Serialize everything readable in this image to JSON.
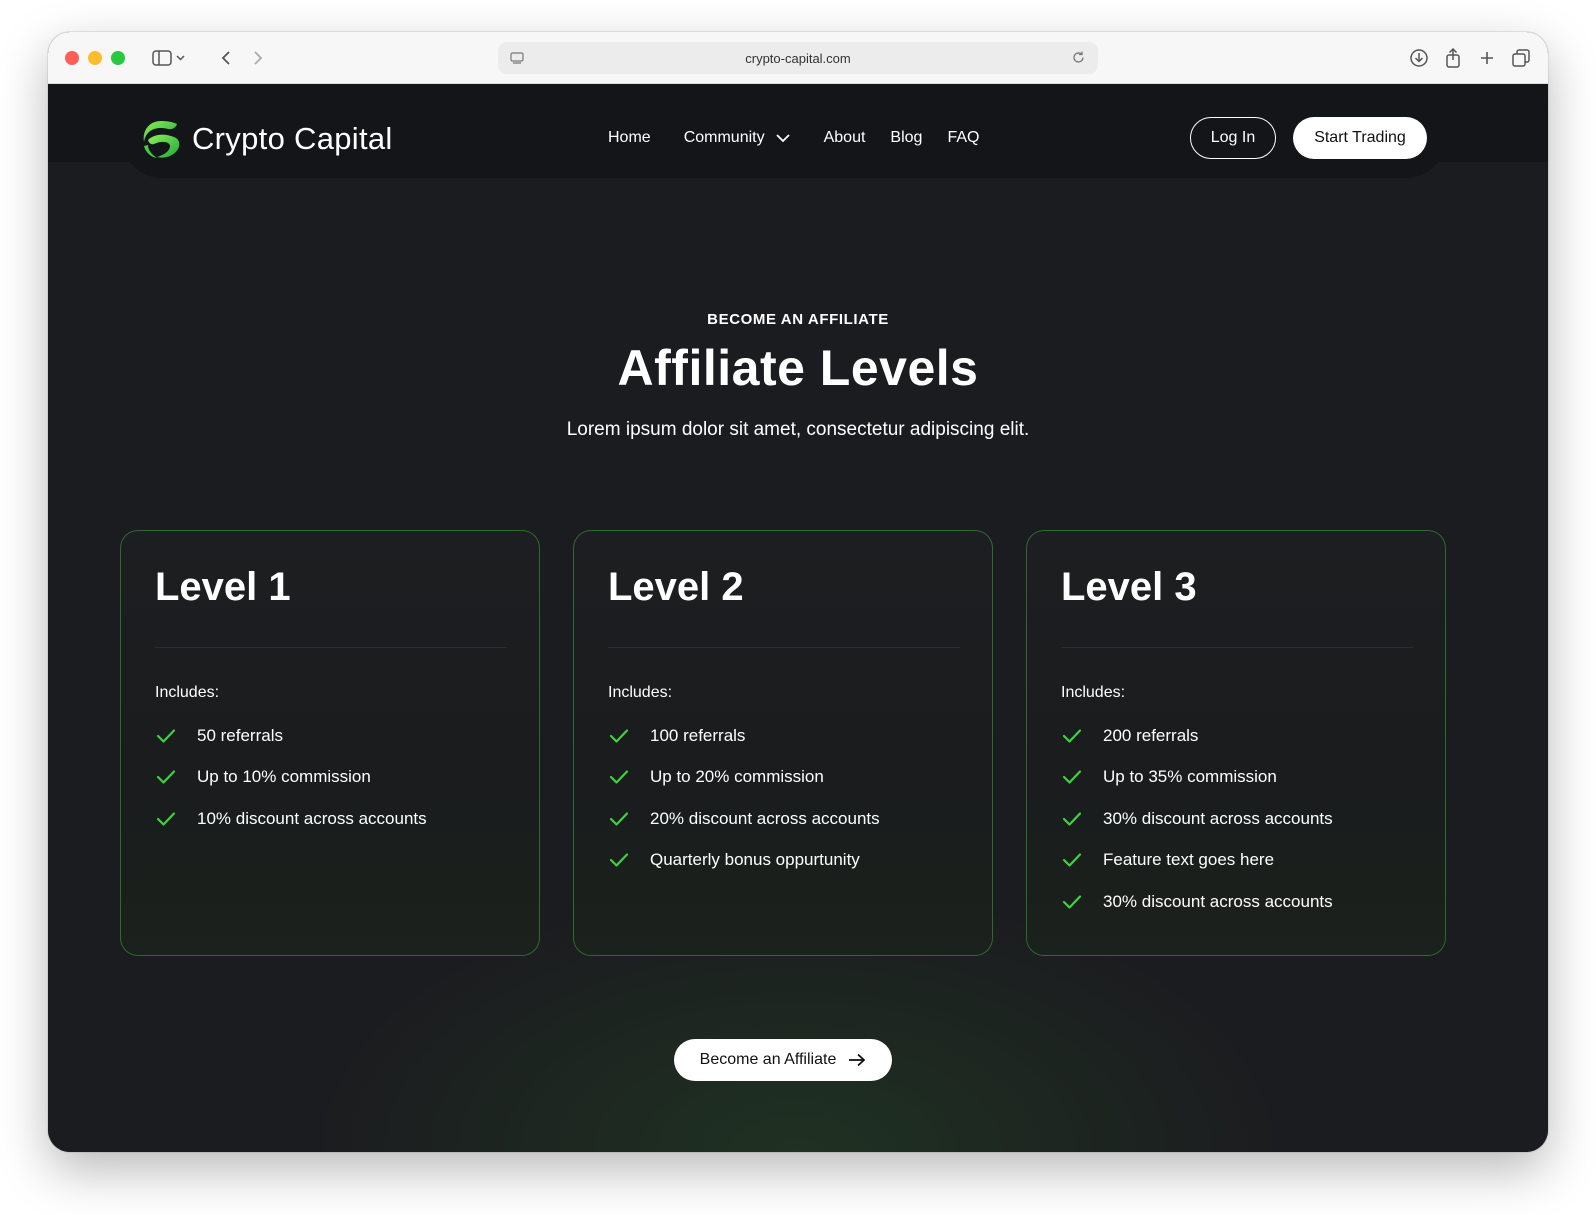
{
  "browser": {
    "url": "crypto-capital.com",
    "icons": [
      "sidebar-toggle-icon",
      "chevron-left-icon",
      "chevron-right-icon",
      "page-icon",
      "reload-icon",
      "download-icon",
      "share-icon",
      "plus-icon",
      "tabs-icon"
    ]
  },
  "nav": {
    "logo_text": "Crypto Capital",
    "links": [
      "Home",
      "Community",
      "About",
      "Blog",
      "FAQ"
    ],
    "login_label": "Log In",
    "start_label": "Start Trading"
  },
  "hero": {
    "eyebrow": "BECOME AN AFFILIATE",
    "title": "Affiliate Levels",
    "subtitle": "Lorem ipsum dolor sit amet, consectetur adipiscing elit."
  },
  "cards": [
    {
      "title": "Level 1",
      "includes_label": "Includes:",
      "features": [
        "50 referrals",
        "Up to 10% commission",
        "10% discount across accounts"
      ]
    },
    {
      "title": "Level 2",
      "includes_label": "Includes:",
      "features": [
        "100 referrals",
        "Up to 20% commission",
        "20% discount across accounts",
        "Quarterly bonus oppurtunity"
      ]
    },
    {
      "title": "Level 3",
      "includes_label": "Includes:",
      "features": [
        "200 referrals",
        "Up to 35% commission",
        "30% discount across accounts",
        "Feature text goes here",
        "30% discount across accounts"
      ]
    }
  ],
  "cta": {
    "label": "Become an Affiliate"
  },
  "colors": {
    "accent_green": "#3fd23f",
    "page_bg": "#1b1c1f",
    "nav_bg": "#141518"
  }
}
